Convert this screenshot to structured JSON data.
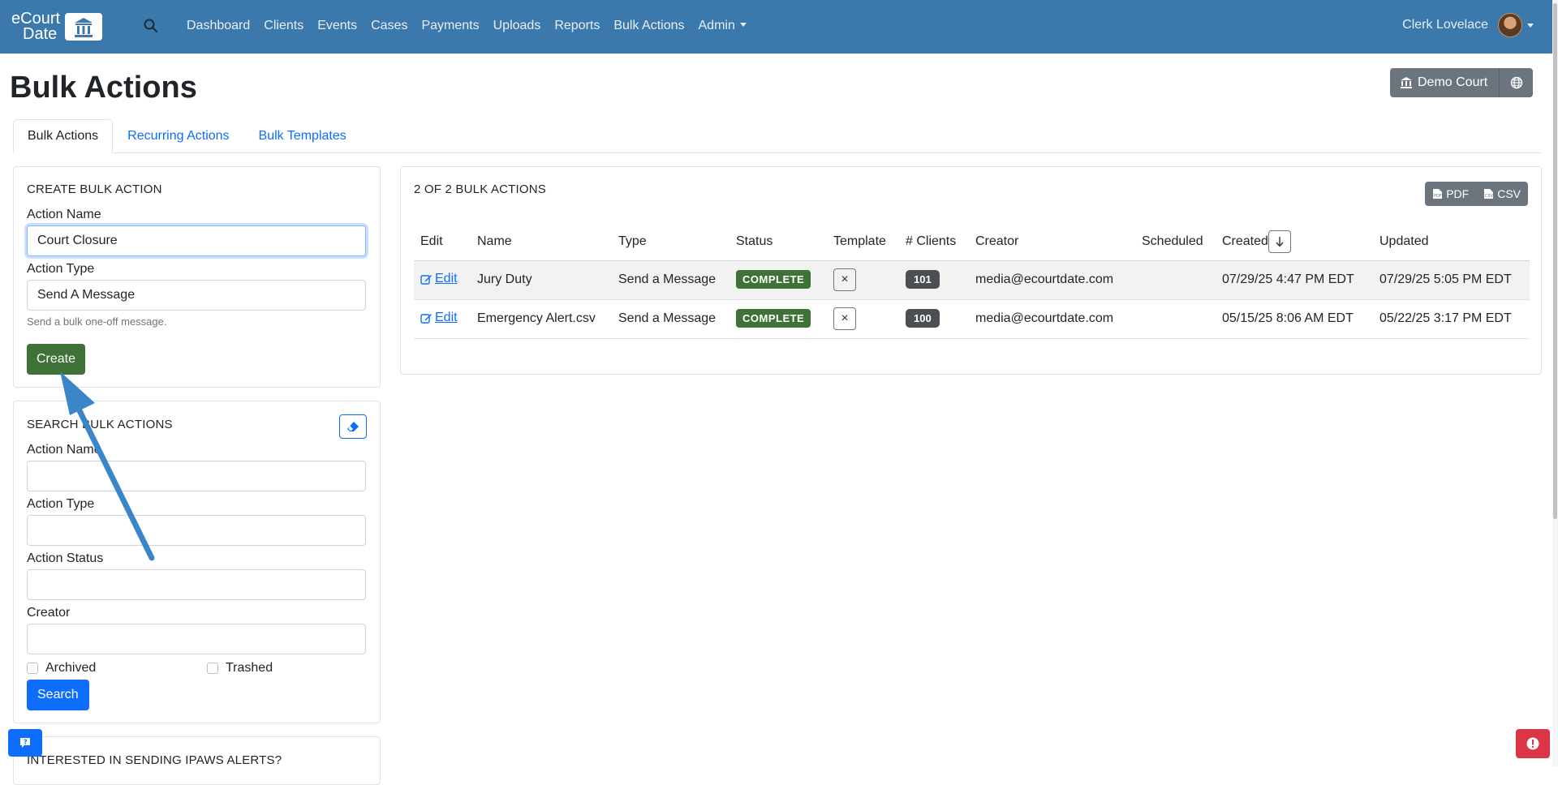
{
  "nav": {
    "logo_line1": "eCourt",
    "logo_line2": "Date",
    "links": [
      {
        "label": "Dashboard"
      },
      {
        "label": "Clients"
      },
      {
        "label": "Events"
      },
      {
        "label": "Cases"
      },
      {
        "label": "Payments"
      },
      {
        "label": "Uploads"
      },
      {
        "label": "Reports"
      },
      {
        "label": "Bulk Actions"
      },
      {
        "label": "Admin"
      }
    ],
    "user_name": "Clerk Lovelace"
  },
  "page": {
    "title": "Bulk Actions",
    "court_button": "Demo Court"
  },
  "tabs": [
    {
      "label": "Bulk Actions",
      "active": true
    },
    {
      "label": "Recurring Actions",
      "active": false
    },
    {
      "label": "Bulk Templates",
      "active": false
    }
  ],
  "create": {
    "heading": "CREATE BULK ACTION",
    "name_label": "Action Name",
    "name_value": "Court Closure",
    "type_label": "Action Type",
    "type_value": "Send A Message",
    "help": "Send a bulk one-off message.",
    "button": "Create"
  },
  "search": {
    "heading": "SEARCH BULK ACTIONS",
    "name_label": "Action Name",
    "type_label": "Action Type",
    "status_label": "Action Status",
    "creator_label": "Creator",
    "archived_label": "Archived",
    "trashed_label": "Trashed",
    "button": "Search"
  },
  "ipaws": {
    "heading": "INTERESTED IN SENDING IPAWS ALERTS?"
  },
  "results": {
    "count_label": "2 OF 2 BULK ACTIONS",
    "export_pdf": "PDF",
    "export_csv": "CSV",
    "columns": [
      "Edit",
      "Name",
      "Type",
      "Status",
      "Template",
      "# Clients",
      "Creator",
      "Scheduled",
      "Created",
      "Updated"
    ],
    "rows": [
      {
        "edit": "Edit",
        "name": "Jury Duty",
        "type": "Send a Message",
        "status": "COMPLETE",
        "template": "×",
        "clients": "101",
        "creator": "media@ecourtdate.com",
        "scheduled": "",
        "created": "07/29/25 4:47 PM EDT",
        "updated": "07/29/25 5:05 PM EDT"
      },
      {
        "edit": "Edit",
        "name": "Emergency Alert.csv",
        "type": "Send a Message",
        "status": "COMPLETE",
        "template": "×",
        "clients": "100",
        "creator": "media@ecourtdate.com",
        "scheduled": "",
        "created": "05/15/25 8:06 AM EDT",
        "updated": "05/22/25 3:17 PM EDT"
      }
    ]
  },
  "colors": {
    "navbar": "#3b79ad",
    "success": "#3e7236",
    "primary": "#0d6efd",
    "secondary": "#6c757d",
    "danger": "#dc3545",
    "annotation_arrow": "#3a86c8"
  }
}
